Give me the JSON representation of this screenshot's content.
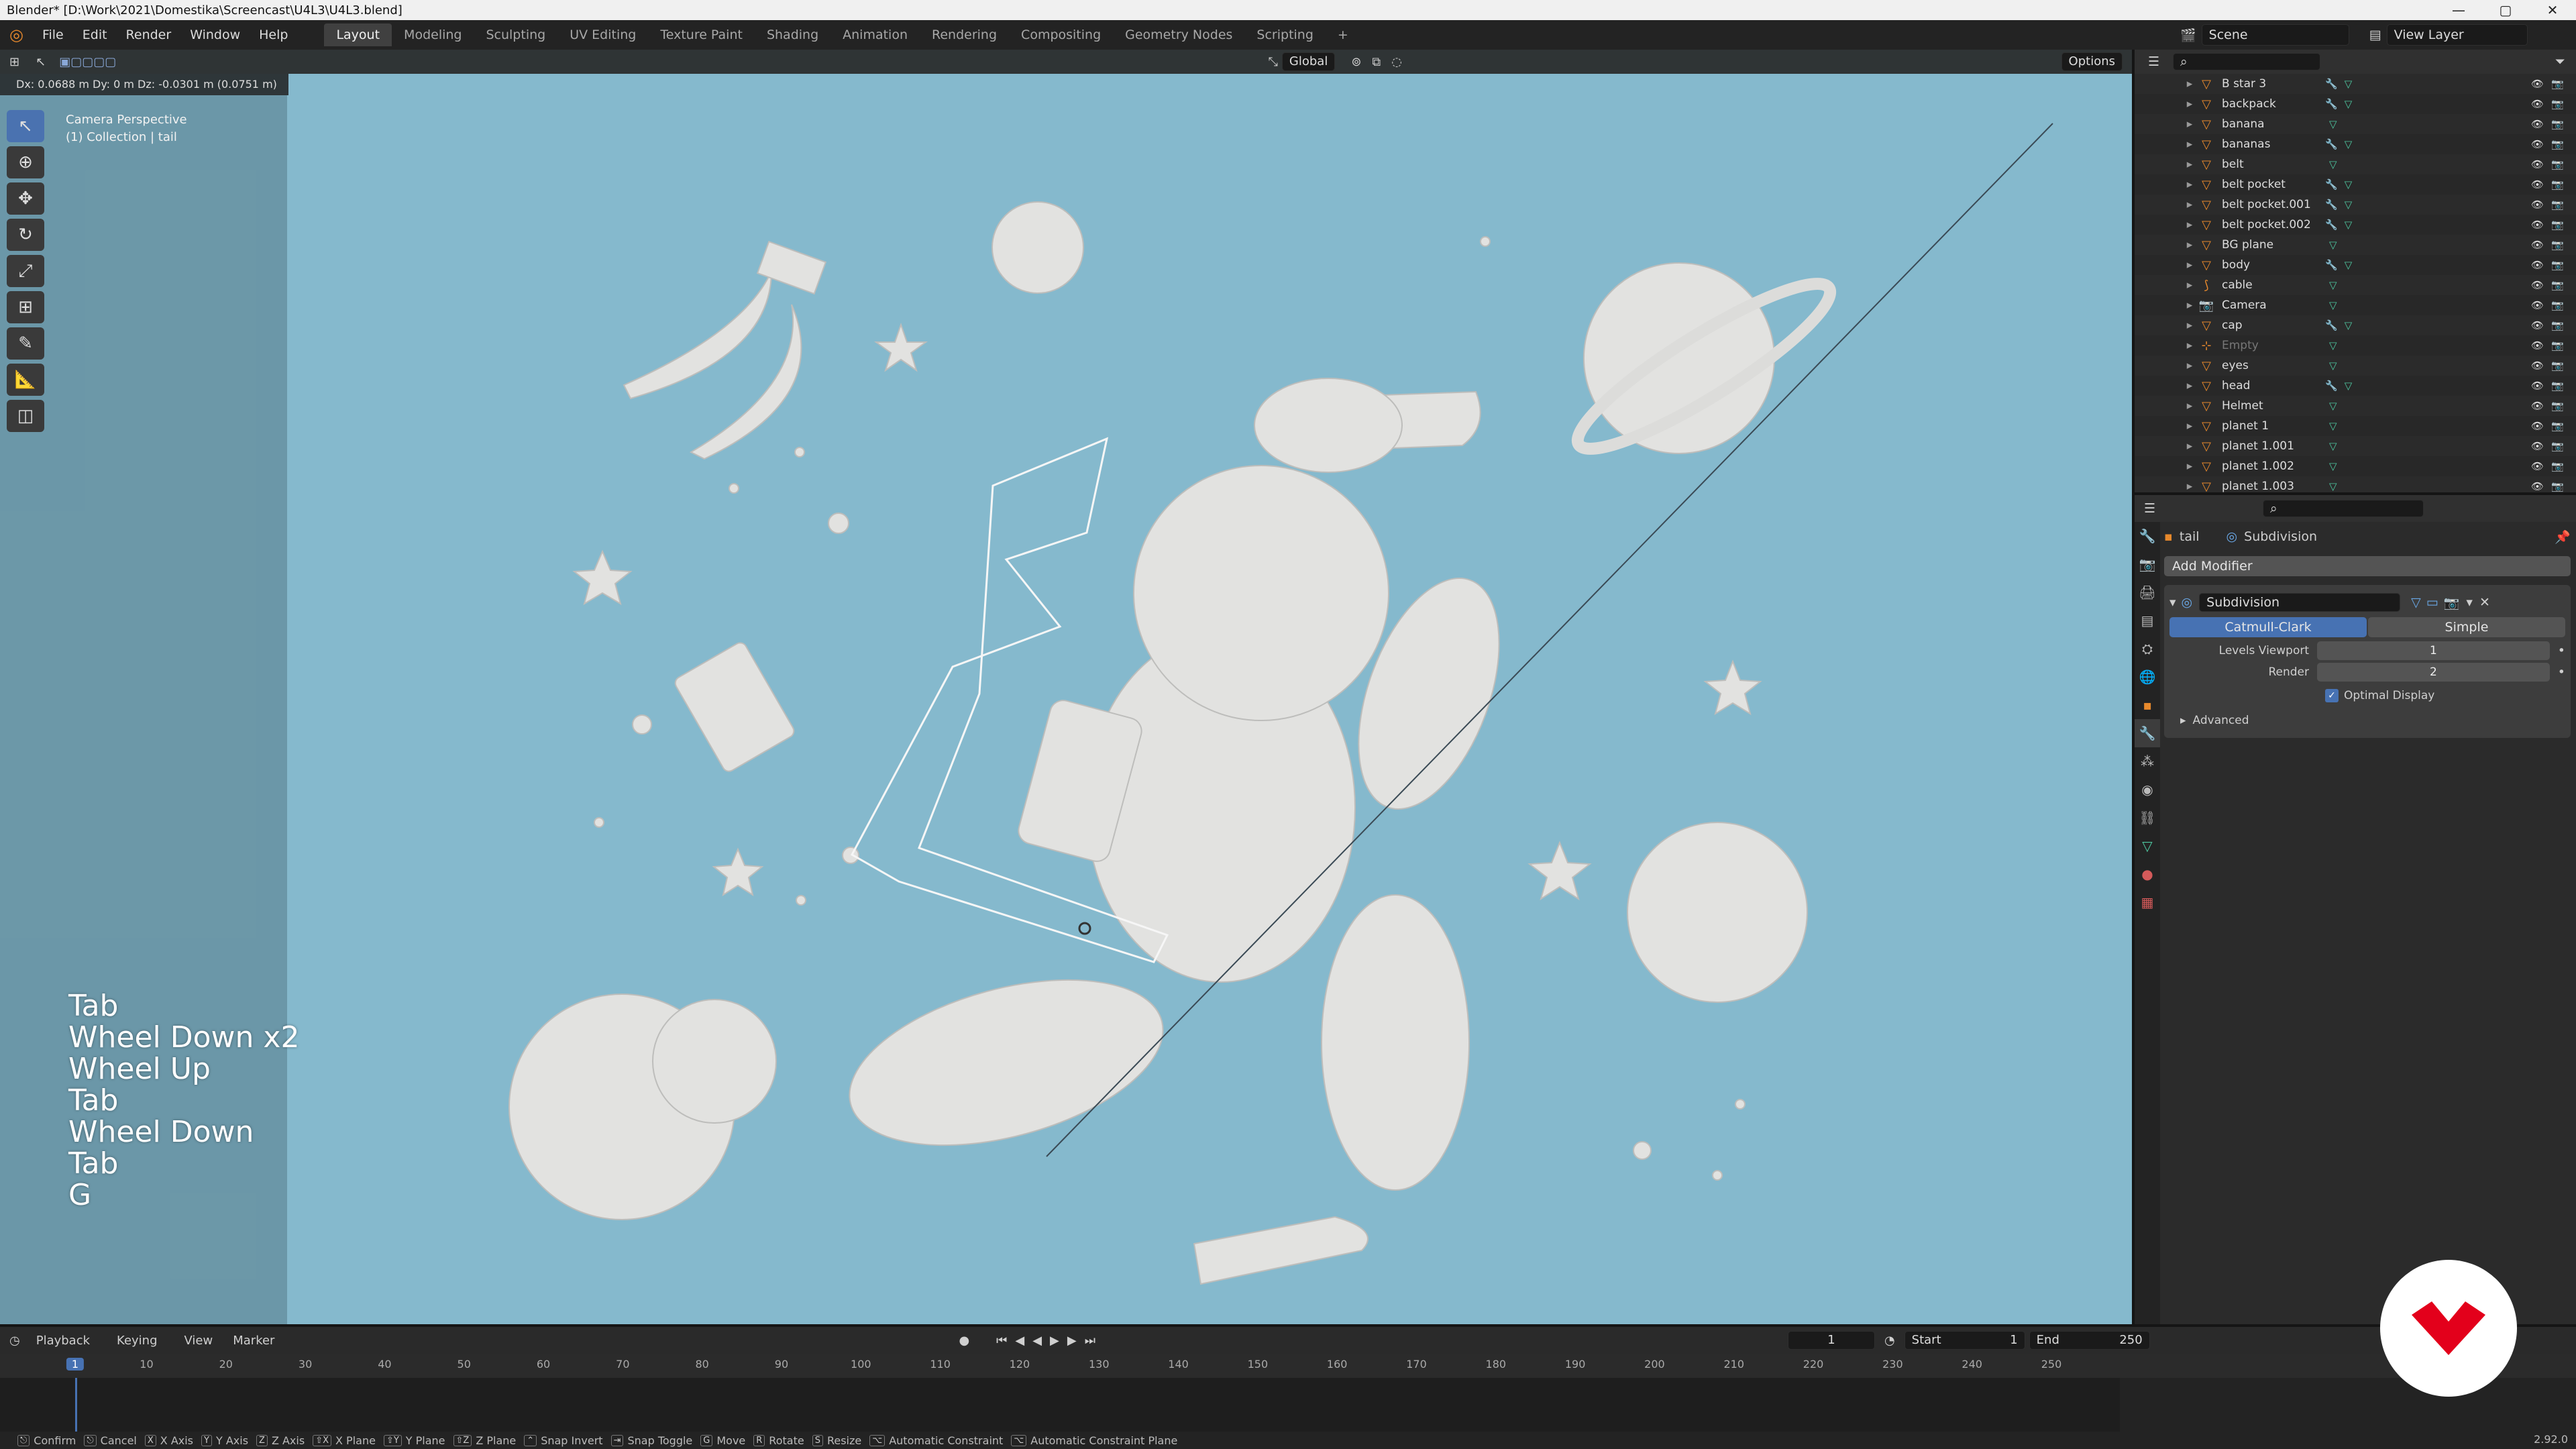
{
  "window": {
    "title": "Blender* [D:\\Work\\2021\\Domestika\\Screencast\\U4L3\\U4L3.blend]",
    "minimize": "—",
    "maximize": "▢",
    "close": "✕"
  },
  "menu": {
    "items": [
      "File",
      "Edit",
      "Render",
      "Window",
      "Help"
    ],
    "workspaces": [
      "Layout",
      "Modeling",
      "Sculpting",
      "UV Editing",
      "Texture Paint",
      "Shading",
      "Animation",
      "Rendering",
      "Compositing",
      "Geometry Nodes",
      "Scripting"
    ],
    "add_tab": "+",
    "scene": "Scene",
    "view_layer": "View Layer"
  },
  "viewport": {
    "transform_orientation": "Global",
    "options_label": "Options",
    "status_readout": "Dx: 0.0688 m  Dy: 0 m  Dz: -0.0301 m (0.0751 m)",
    "perspective": "Camera Perspective",
    "collection": "(1) Collection | tail",
    "key_log": [
      "Tab",
      "Wheel Down x2",
      "Wheel Up",
      "Tab",
      "Wheel Down",
      "Tab",
      "G"
    ],
    "background": "#85b9cd"
  },
  "outliner": {
    "rows": [
      {
        "name": "B star 3",
        "mods": true,
        "dim": false,
        "icon": "mesh"
      },
      {
        "name": "backpack",
        "mods": true,
        "dim": false,
        "icon": "mesh"
      },
      {
        "name": "banana",
        "mods": false,
        "dim": false,
        "icon": "mesh"
      },
      {
        "name": "bananas",
        "mods": true,
        "dim": false,
        "icon": "mesh"
      },
      {
        "name": "belt",
        "mods": false,
        "dim": false,
        "icon": "mesh"
      },
      {
        "name": "belt pocket",
        "mods": true,
        "dim": false,
        "icon": "mesh"
      },
      {
        "name": "belt pocket.001",
        "mods": true,
        "dim": false,
        "icon": "mesh"
      },
      {
        "name": "belt pocket.002",
        "mods": true,
        "dim": false,
        "icon": "mesh"
      },
      {
        "name": "BG plane",
        "mods": false,
        "dim": false,
        "icon": "mesh"
      },
      {
        "name": "body",
        "mods": true,
        "dim": false,
        "icon": "mesh"
      },
      {
        "name": "cable",
        "mods": false,
        "dim": false,
        "icon": "curve"
      },
      {
        "name": "Camera",
        "mods": false,
        "dim": false,
        "icon": "camera"
      },
      {
        "name": "cap",
        "mods": true,
        "dim": false,
        "icon": "mesh"
      },
      {
        "name": "Empty",
        "mods": false,
        "dim": true,
        "icon": "empty"
      },
      {
        "name": "eyes",
        "mods": false,
        "dim": false,
        "icon": "mesh"
      },
      {
        "name": "head",
        "mods": true,
        "dim": false,
        "icon": "mesh"
      },
      {
        "name": "Helmet",
        "mods": false,
        "dim": false,
        "icon": "mesh"
      },
      {
        "name": "planet 1",
        "mods": false,
        "dim": false,
        "icon": "mesh"
      },
      {
        "name": "planet 1.001",
        "mods": false,
        "dim": false,
        "icon": "mesh"
      },
      {
        "name": "planet 1.002",
        "mods": false,
        "dim": false,
        "icon": "mesh"
      },
      {
        "name": "planet 1.003",
        "mods": false,
        "dim": false,
        "icon": "mesh"
      }
    ]
  },
  "properties": {
    "object_name": "tail",
    "modifier_context": "Subdivision",
    "add_modifier": "Add Modifier",
    "modifier": {
      "name": "Subdivision",
      "mode_catmull": "Catmull-Clark",
      "mode_simple": "Simple",
      "levels_viewport_label": "Levels Viewport",
      "levels_viewport": "1",
      "render_label": "Render",
      "render": "2",
      "optimal_display": "Optimal Display",
      "advanced": "Advanced"
    }
  },
  "timeline": {
    "menus": [
      "Playback",
      "Keying",
      "View",
      "Marker"
    ],
    "current_frame": "1",
    "start_label": "Start",
    "start": "1",
    "end_label": "End",
    "end": "250",
    "ruler": [
      "1",
      "10",
      "20",
      "30",
      "40",
      "50",
      "60",
      "70",
      "80",
      "90",
      "100",
      "110",
      "120",
      "130",
      "140",
      "150",
      "160",
      "170",
      "180",
      "190",
      "200",
      "210",
      "220",
      "230",
      "240",
      "250"
    ]
  },
  "statusbar": {
    "items": [
      {
        "key": "⎋",
        "label": "Confirm"
      },
      {
        "key": "⎋",
        "label": "Cancel"
      },
      {
        "key": "X",
        "label": "X Axis"
      },
      {
        "key": "Y",
        "label": "Y Axis"
      },
      {
        "key": "Z",
        "label": "Z Axis"
      },
      {
        "key": "⇧X",
        "label": "X Plane"
      },
      {
        "key": "⇧Y",
        "label": "Y Plane"
      },
      {
        "key": "⇧Z",
        "label": "Z Plane"
      },
      {
        "key": "⌃",
        "label": "Snap Invert"
      },
      {
        "key": "⇥",
        "label": "Snap Toggle"
      },
      {
        "key": "G",
        "label": "Move"
      },
      {
        "key": "R",
        "label": "Rotate"
      },
      {
        "key": "S",
        "label": "Resize"
      },
      {
        "key": "⌥",
        "label": "Automatic Constraint"
      },
      {
        "key": "⌥",
        "label": "Automatic Constraint Plane"
      }
    ],
    "version": "2.92.0"
  },
  "colors": {
    "accent_blue": "#4772b3",
    "object_orange": "#e8892c",
    "logo_red": "#e3001b"
  }
}
